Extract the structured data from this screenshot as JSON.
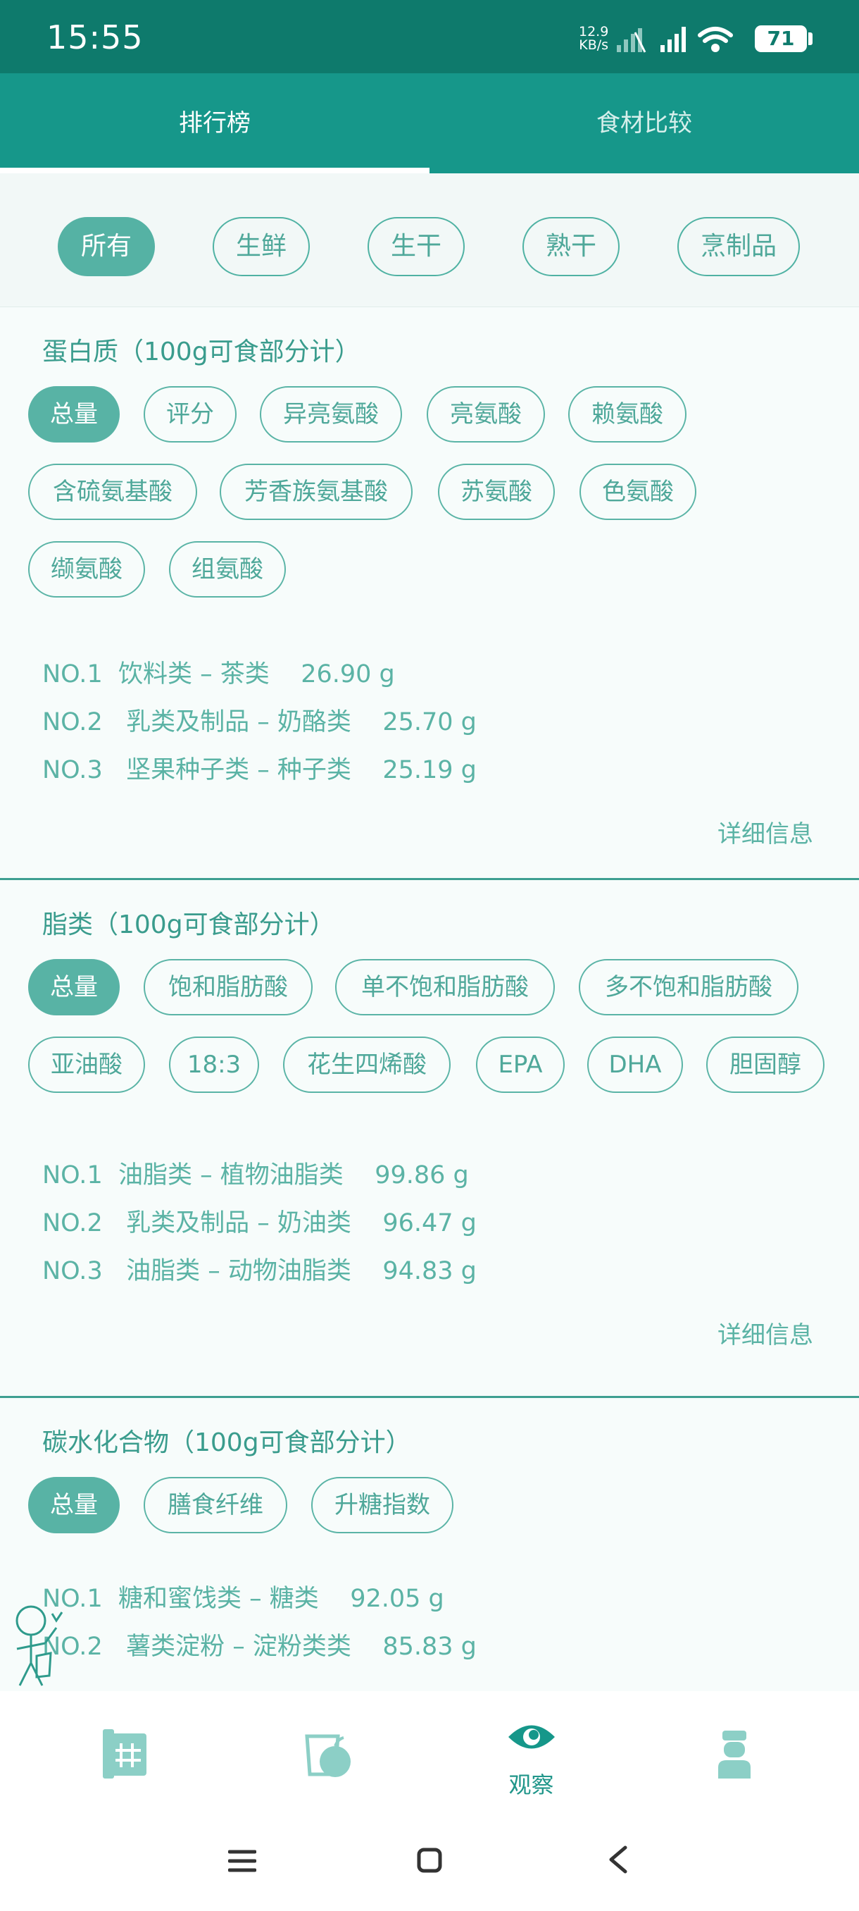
{
  "status_bar": {
    "time": "15:55",
    "net_speed_value": "12.9",
    "net_speed_unit": "KB/s",
    "battery": "71"
  },
  "top_tabs": [
    "排行榜",
    "食材比较"
  ],
  "categories": [
    "所有",
    "生鲜",
    "生干",
    "熟干",
    "烹制品"
  ],
  "sections": {
    "protein": {
      "title": "蛋白质（100g可食部分计）",
      "chips": [
        "总量",
        "评分",
        "异亮氨酸",
        "亮氨酸",
        "赖氨酸",
        "含硫氨基酸",
        "芳香族氨基酸",
        "苏氨酸",
        "色氨酸",
        "缬氨酸",
        "组氨酸"
      ],
      "ranks": [
        "NO.1  饮料类 – 茶类    26.90 g",
        "NO.2   乳类及制品 – 奶酪类    25.70 g",
        "NO.3   坚果种子类 – 种子类    25.19 g"
      ],
      "detail": "详细信息"
    },
    "fat": {
      "title": "脂类（100g可食部分计）",
      "chips": [
        "总量",
        "饱和脂肪酸",
        "单不饱和脂肪酸",
        "多不饱和脂肪酸",
        "亚油酸",
        "18:3",
        "花生四烯酸",
        "EPA",
        "DHA",
        "胆固醇"
      ],
      "ranks": [
        "NO.1  油脂类 – 植物油脂类    99.86 g",
        "NO.2   乳类及制品 – 奶油类    96.47 g",
        "NO.3   油脂类 – 动物油脂类    94.83 g"
      ],
      "detail": "详细信息"
    },
    "carb": {
      "title": "碳水化合物（100g可食部分计）",
      "chips": [
        "总量",
        "膳食纤维",
        "升糖指数"
      ],
      "ranks": [
        "NO.1  糖和蜜饯类 – 糖类    92.05 g",
        "NO.2   薯类淀粉 – 淀粉类类    85.83 g"
      ]
    }
  },
  "bottom_nav": {
    "items": [
      {
        "icon": "calculator-grid-icon",
        "label": ""
      },
      {
        "icon": "food-apple-icon",
        "label": ""
      },
      {
        "icon": "eye-icon",
        "label": "观察"
      },
      {
        "icon": "doctor-icon",
        "label": ""
      }
    ]
  },
  "colors": {
    "status_bar": "#0e7a6c",
    "primary": "#16978a",
    "accent_chip": "#58b3a5",
    "text_teal": "#4fa89a"
  }
}
